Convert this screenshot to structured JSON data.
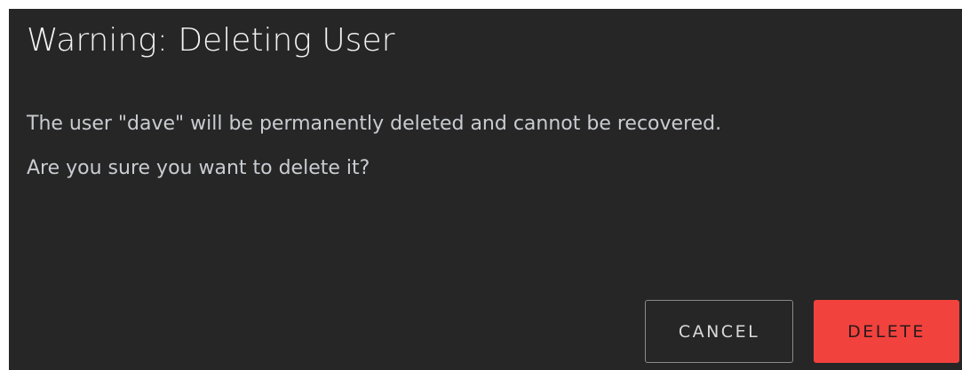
{
  "dialog": {
    "title": "Warning: Deleting User",
    "message_line1": "The user \"dave\" will be permanently deleted and cannot be recovered.",
    "message_line2": "Are you sure you want to delete it?",
    "buttons": {
      "cancel_label": "CANCEL",
      "delete_label": "DELETE"
    }
  },
  "colors": {
    "dialog_background": "#262626",
    "danger": "#f1423e",
    "cancel_border": "#8a8a8a"
  }
}
